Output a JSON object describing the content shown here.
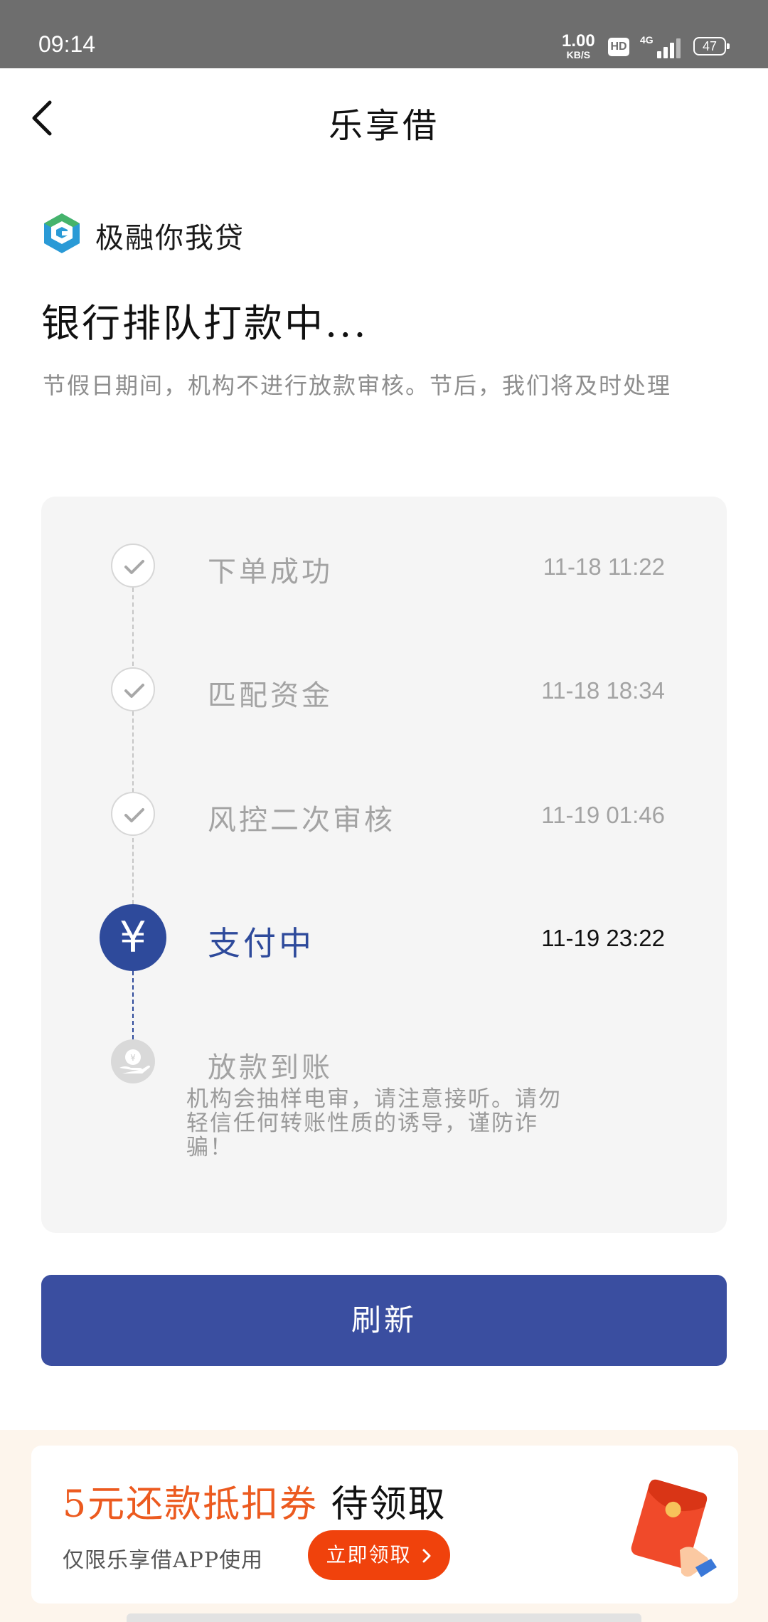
{
  "status_bar": {
    "time": "09:14",
    "speed_value": "1.00",
    "speed_unit": "KB/S",
    "hd": "HD",
    "network": "4G",
    "battery": "47"
  },
  "header": {
    "title": "乐享借",
    "back_icon": "chevron-left-icon"
  },
  "brand": {
    "name": "极融你我贷",
    "logo_icon": "g-logo-icon"
  },
  "status": {
    "heading": "银行排队打款中...",
    "note": "节假日期间，机构不进行放款审核。节后，我们将及时处理"
  },
  "timeline": {
    "steps": [
      {
        "label": "下单成功",
        "time": "11-18 11:22",
        "state": "done",
        "icon": "check-icon"
      },
      {
        "label": "匹配资金",
        "time": "11-18 18:34",
        "state": "done",
        "icon": "check-icon"
      },
      {
        "label": "风控二次审核",
        "time": "11-19 01:46",
        "state": "done",
        "icon": "check-icon"
      },
      {
        "label": "支付中",
        "time": "11-19 23:22",
        "state": "active",
        "icon": "yuan-icon"
      },
      {
        "label": "放款到账",
        "time": "",
        "state": "pending",
        "icon": "hand-coin-icon"
      }
    ],
    "pending_note": "机构会抽样电审，请注意接听。请勿轻信任何转账性质的诱导，谨防诈骗！"
  },
  "actions": {
    "refresh_label": "刷新"
  },
  "promo": {
    "title_highlight": "5元还款抵扣券",
    "title_rest": "待领取",
    "subtitle": "仅限乐享借APP使用",
    "claim_label": "立即领取",
    "claim_icon": "chevron-right-icon",
    "image_icon": "red-envelope-icon",
    "accent_color": "#f0420c"
  },
  "colors": {
    "primary": "#3a4ea0",
    "active_step": "#2e4a9b",
    "muted_text": "#a3a3a3",
    "promo_highlight": "#ec5a1f"
  }
}
